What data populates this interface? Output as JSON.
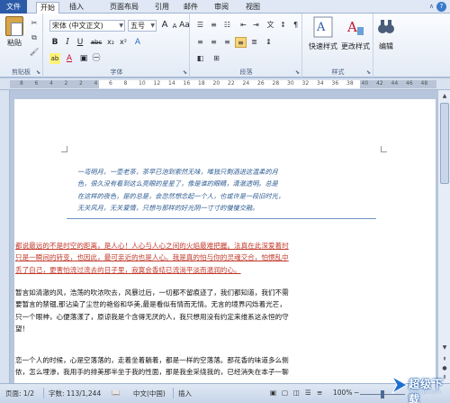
{
  "tabs": [
    "文件",
    "开始",
    "插入",
    "页面布局",
    "引用",
    "邮件",
    "审阅",
    "视图"
  ],
  "active_tab": "开始",
  "ribbon": {
    "clipboard": {
      "label": "剪贴板",
      "paste": "粘贴"
    },
    "font": {
      "label": "字体",
      "family": "宋体 (中文正文)",
      "size": "五号",
      "grow": "A",
      "shrink": "A",
      "case": "Aa",
      "bold": "B",
      "italic": "I",
      "underline": "U",
      "strike": "abc",
      "sub": "x₂",
      "sup": "x²",
      "color_letter": "A",
      "highlight": "ab"
    },
    "paragraph": {
      "label": "段落"
    },
    "styles": {
      "label": "样式",
      "quick": "快速样式",
      "change": "更改样式"
    },
    "editing": {
      "label": "编辑"
    }
  },
  "ruler_numbers": [
    "8",
    "6",
    "4",
    "2",
    "2",
    "4",
    "6",
    "8",
    "10",
    "12",
    "14",
    "16",
    "18",
    "20",
    "22",
    "24",
    "26",
    "28",
    "30",
    "32",
    "34",
    "36",
    "38",
    "40",
    "42",
    "44",
    "46",
    "48"
  ],
  "document": {
    "quote_lines": [
      "一弯明月，一壶老茶，茶早已泡到索然无味，唯独只剩酒进这温柔的月",
      "色，很久没有看到这么亮眼的星星了，像是谁的眼睛，清澈透明。总是",
      "在这样的夜色，是的总是，会忽然想念起一个人，也或许是一段旧时光，",
      "无关风月，无关爱情，只想与那样的好光阴一寸寸的慢慢交融。"
    ],
    "red_lines": [
      "都说最远的不是时空的距离，是人心！人心与人心之间的火焰最难把握。法真在此深爱着时",
      "只是一瞬间的转变，也因此，最可亲近的也是人心。我是真的怕与你的灵魂交合，怕惯乱中",
      "丢了自己，更害怕流过流去的日子里，寂寞会香结已流淌平淡而温润的心。"
    ],
    "para1_lines": [
      "暂言如清澈的风，浩荡的吹浓吹去，风暴过后，一切都不留痕迹了，我们都知道，我们不需",
      "要暂言的禁锢,那沾染了尘世的艳俗和华美,最是看似有情而无情。无言的境界闪烁着光芒，",
      "只一个眼神，心便落漾了，原谅我是个含得无厌的人，我只想用没有约定来维系这永恒的守",
      "望！"
    ],
    "para2_lines": [
      "恋一个人的时候，心是空落落的，走着坐着躺着，都是一样的空落落。那花香的味道多么侧",
      "侬，怎么埋渗，我用手的排美那半坐于我的性面，那是我金采绕我的，已经消失在本子一聊"
    ]
  },
  "status": {
    "page": "页面: 1/2",
    "words": "字数: 113/1,244",
    "lang": "中文(中国)",
    "insert": "插入",
    "zoom": "100%",
    "zoom_value": 100
  },
  "watermark": {
    "text": "超级下载",
    "sub": "www.cjxz.com"
  }
}
